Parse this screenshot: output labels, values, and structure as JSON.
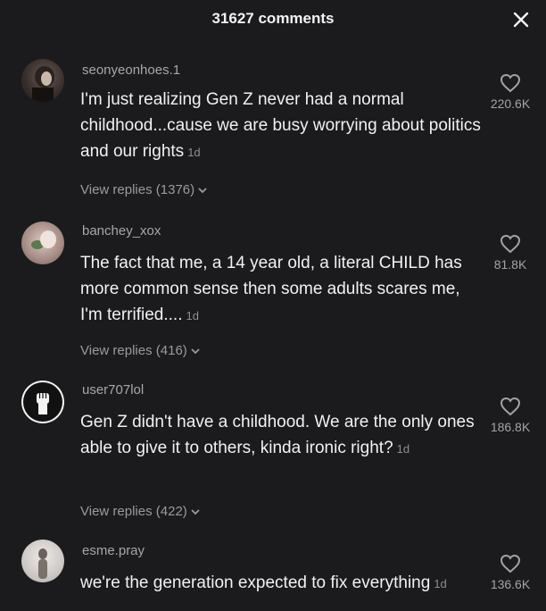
{
  "header": {
    "title": "31627 comments",
    "close_icon": "close-icon"
  },
  "comments": [
    {
      "username": "seonyeonhoes.1",
      "text": "I'm just realizing Gen Z never had a normal childhood...cause we are busy worrying about politics and our rights",
      "age": "1d",
      "replies": "View replies (1376)",
      "likes": "220.6K"
    },
    {
      "username": "banchey_xox",
      "text": "The fact that me, a 14 year old, a literal CHILD has more common sense then some adults scares me, I'm terrified....",
      "age": "1d",
      "replies": "View replies (416)",
      "likes": "81.8K"
    },
    {
      "username": "user707lol",
      "text": "Gen Z didn't have a childhood. We are the only ones able to give it to others, kinda ironic right?",
      "age": "1d",
      "replies": "View replies (422)",
      "likes": "186.8K"
    },
    {
      "username": "esme.pray",
      "text": "we're the generation expected to fix everything",
      "age": "1d",
      "likes": "136.6K"
    }
  ],
  "colors": {
    "background": "#1b1b1d",
    "text_primary": "#f1f1f1",
    "text_secondary": "#a7a7ab"
  }
}
